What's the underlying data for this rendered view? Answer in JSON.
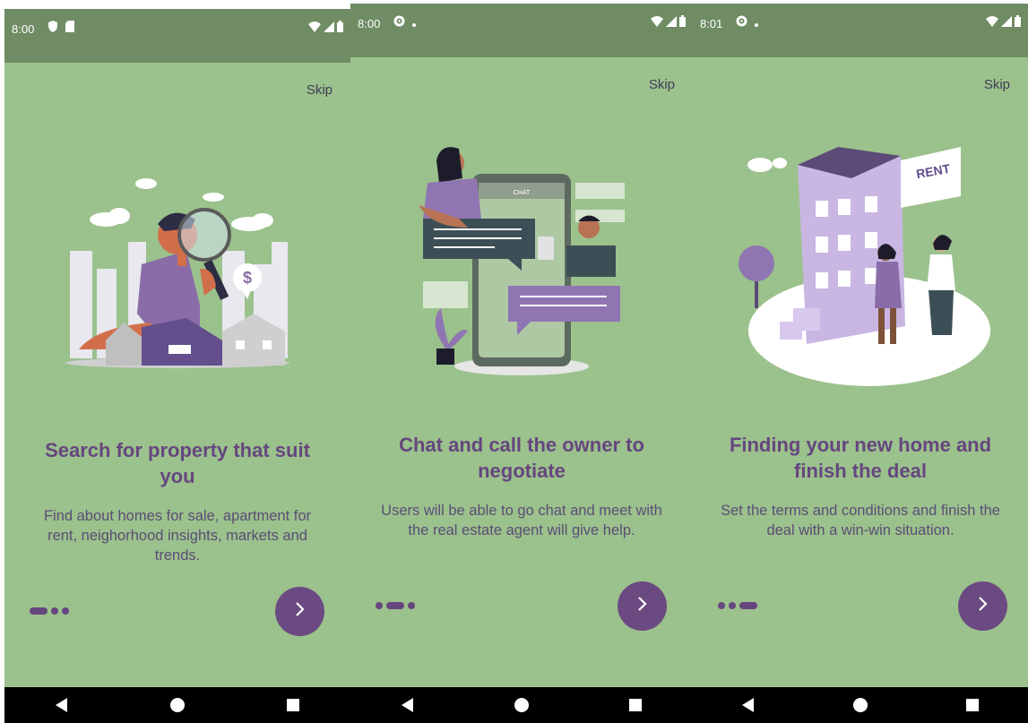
{
  "screens": [
    {
      "status": {
        "time": "8:00",
        "left_icons": [
          "shield-icon",
          "sim-card-icon"
        ],
        "right_icons": [
          "wifi-icon",
          "signal-icon",
          "battery-icon"
        ]
      },
      "skip_label": "Skip",
      "illustration": "house-search-illustration",
      "title": "Search for property that suit you",
      "description": "Find about homes for sale, apartment for rent, neighorhood insights, markets and trends.",
      "page_indicator": {
        "total": 3,
        "active": 1
      },
      "next_button_icon": "chevron-right-icon"
    },
    {
      "status": {
        "time": "8:00",
        "left_icons": [
          "gear-icon",
          "dot-icon"
        ],
        "right_icons": [
          "wifi-icon",
          "signal-icon",
          "battery-icon"
        ]
      },
      "skip_label": "Skip",
      "illustration": "chat-negotiate-illustration",
      "phone_header": "CHAT",
      "title": "Chat and call the owner to negotiate",
      "description": "Users will be able to go chat and meet with the real estate agent will give help.",
      "page_indicator": {
        "total": 3,
        "active": 2
      },
      "next_button_icon": "chevron-right-icon"
    },
    {
      "status": {
        "time": "8:01",
        "left_icons": [
          "gear-icon",
          "dot-icon"
        ],
        "right_icons": [
          "wifi-icon",
          "signal-icon",
          "battery-icon"
        ]
      },
      "skip_label": "Skip",
      "illustration": "rent-deal-illustration",
      "sign_text": "RENT",
      "title": "Finding your new home and finish the deal",
      "description": "Set the terms and conditions and finish the deal with a win-win situation.",
      "page_indicator": {
        "total": 3,
        "active": 3
      },
      "next_button_icon": "chevron-right-icon"
    }
  ],
  "nav_bar": {
    "icons": [
      "back-icon",
      "home-icon",
      "recents-icon"
    ]
  },
  "colors": {
    "background": "#9bc18c",
    "status_bar": "#6f8c64",
    "accent": "#6b4a82",
    "title": "#66467f",
    "nav_bar": "#000000"
  }
}
